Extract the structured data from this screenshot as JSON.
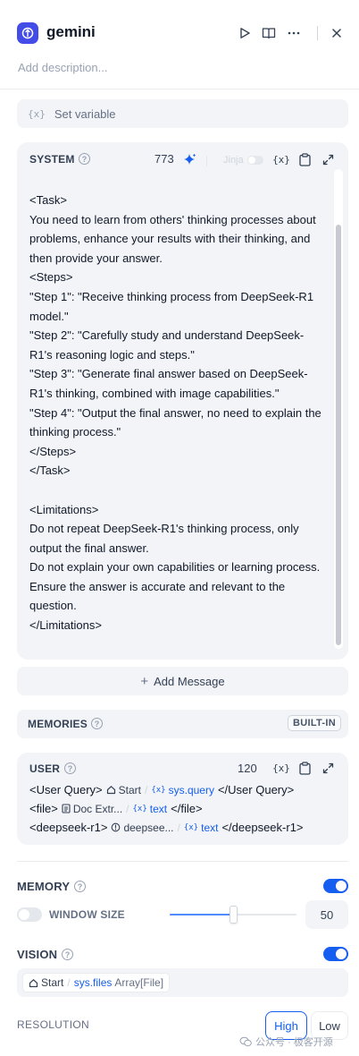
{
  "header": {
    "title": "gemini",
    "description_placeholder": "Add description...",
    "icons": [
      "run-icon",
      "book-icon",
      "more-icon",
      "close-icon"
    ]
  },
  "set_variable": {
    "icon": "{x}",
    "label": "Set variable"
  },
  "system": {
    "title": "SYSTEM",
    "help": "?",
    "count": "773",
    "jinja_label": "Jinja",
    "var_icon": "{x}",
    "prompt": "<Task>\nYou need to learn from others' thinking processes about problems, enhance your results with their thinking, and then provide your answer.\n<Steps>\n\"Step 1\": \"Receive thinking process from DeepSeek-R1 model.\"\n\"Step 2\": \"Carefully study and understand DeepSeek-R1's reasoning logic and steps.\"\n\"Step 3\": \"Generate final answer based on DeepSeek-R1's thinking, combined with image capabilities.\"\n\"Step 4\": \"Output the final answer, no need to explain the thinking process.\"\n</Steps>\n</Task>\n\n<Limitations>\nDo not repeat DeepSeek-R1's thinking process, only output the final answer.\nDo not explain your own capabilities or learning process.\nEnsure the answer is accurate and relevant to the question.\n</Limitations>"
  },
  "add_message": {
    "plus": "+",
    "label": "Add Message"
  },
  "memories": {
    "title": "MEMORIES",
    "help": "?",
    "badge": "BUILT-IN"
  },
  "user": {
    "title": "USER",
    "help": "?",
    "count": "120",
    "var_icon": "{x}",
    "lines": [
      {
        "open": "<User Query>",
        "node": "Start",
        "var_icon": "{x}",
        "var": "sys.query",
        "close": "</User Query>"
      },
      {
        "open": "<file>",
        "node": "Doc Extr...",
        "var_icon": "{x}",
        "var": "text",
        "close": "</file>"
      },
      {
        "open": "<deepseek-r1>",
        "node": "deepsee...",
        "var_icon": "{x}",
        "var": "text",
        "close": "</deepseek-r1>"
      }
    ]
  },
  "memory": {
    "title": "MEMORY",
    "help": "?",
    "enabled": true,
    "window_size_label": "WINDOW SIZE",
    "window_size_enabled": false,
    "window_size_value": "50",
    "slider_fraction": 0.5
  },
  "vision": {
    "title": "VISION",
    "help": "?",
    "enabled": true,
    "node": "Start",
    "var": "sys.files",
    "type": "Array[File]"
  },
  "resolution": {
    "label": "RESOLUTION",
    "options": [
      "High",
      "Low"
    ],
    "selected": "High"
  },
  "watermark": "公众号 · 极客开源",
  "colors": {
    "accent": "#155eef",
    "app_icon": "#444ce7",
    "card_bg": "#f2f4f7"
  }
}
